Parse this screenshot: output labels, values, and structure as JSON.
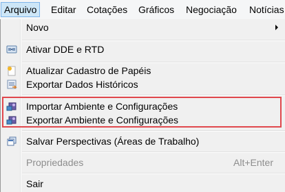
{
  "menubar": {
    "items": [
      "Arquivo",
      "Editar",
      "Cotações",
      "Gráficos",
      "Negociação",
      "Notícias"
    ]
  },
  "menu": {
    "items": [
      {
        "label": "Novo",
        "icon": "none",
        "submenu": true
      },
      {
        "label": "Ativar DDE e RTD",
        "icon": "dde-link-icon"
      },
      {
        "label": "Atualizar Cadastro de Papéis",
        "icon": "refresh-registry-icon"
      },
      {
        "label": "Exportar Dados Históricos",
        "icon": "export-history-icon"
      },
      {
        "label": "Importar Ambiente e Configurações",
        "icon": "import-settings-icon"
      },
      {
        "label": "Exportar Ambiente e Configurações",
        "icon": "export-settings-icon"
      },
      {
        "label": "Salvar Perspectivas (Áreas de Trabalho)",
        "icon": "save-perspectives-icon"
      },
      {
        "label": "Propriedades",
        "shortcut": "Alt+Enter",
        "disabled": true
      },
      {
        "label": "Sair",
        "icon": "none"
      }
    ]
  },
  "colors": {
    "active_menu_bg": "#cde6f7",
    "active_menu_border": "#7eb4ea",
    "highlight_border": "#e0474c",
    "disabled_text": "#8d8d8d"
  }
}
